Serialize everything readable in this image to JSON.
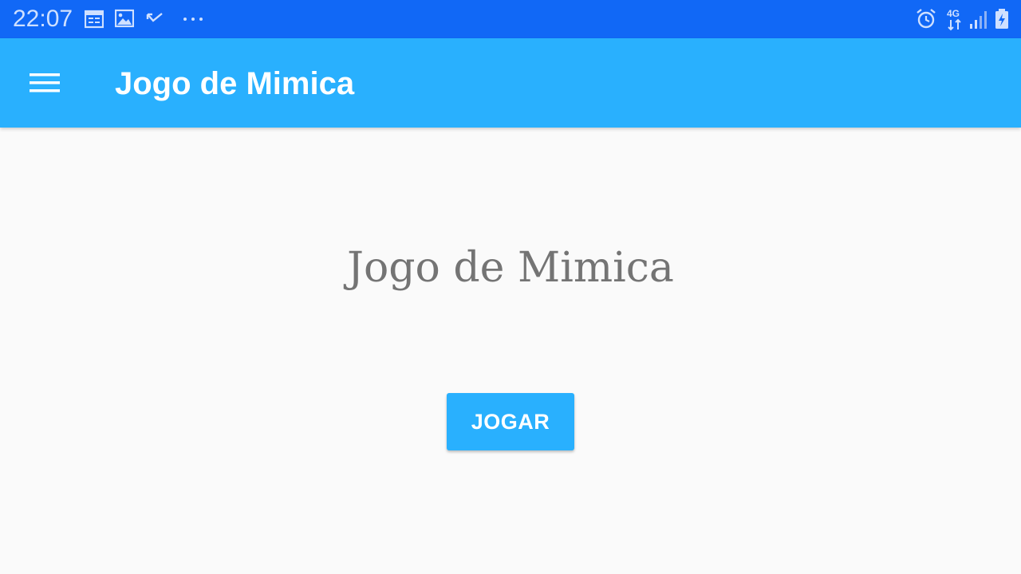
{
  "status_bar": {
    "time": "22:07",
    "network_label": "4G",
    "icons": [
      "calendar-icon",
      "image-icon",
      "missed-call-icon",
      "more-dots-icon",
      "alarm-icon",
      "network-4g-icon",
      "signal-icon",
      "battery-charging-icon"
    ]
  },
  "app_bar": {
    "title": "Jogo de Mimica",
    "menu_icon": "hamburger-menu-icon"
  },
  "main": {
    "title": "Jogo de Mimica",
    "play_label": "JOGAR"
  },
  "colors": {
    "status_bar": "#1168f6",
    "app_bar": "#29b0fe",
    "background": "#fafafa",
    "title_text": "#747474",
    "button": "#29b0fe"
  }
}
